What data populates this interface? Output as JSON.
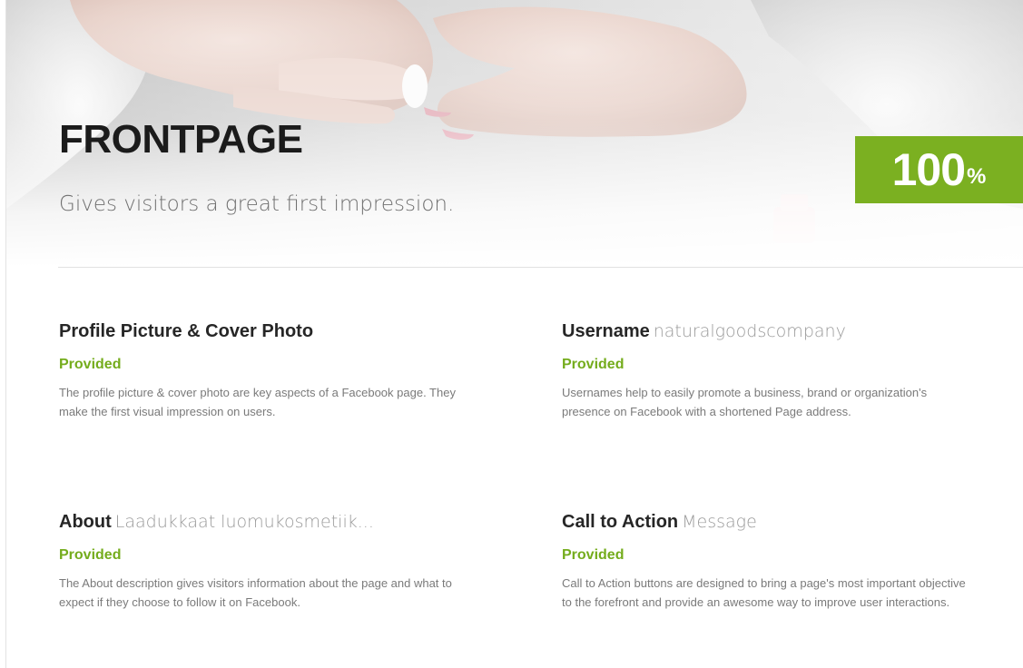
{
  "hero": {
    "title": "FRONTPAGE",
    "subtitle": "Gives visitors a great first impression.",
    "score": {
      "value": "100",
      "unit": "%"
    }
  },
  "items": [
    {
      "name": "Profile Picture & Cover Photo",
      "value": "",
      "status": "Provided",
      "description": "The profile picture & cover photo are key aspects of a Facebook page. They make the first visual impression on users."
    },
    {
      "name": "Username",
      "value": "naturalgoodscompany",
      "status": "Provided",
      "description": "Usernames help to easily promote a business, brand or organization's presence on Facebook with a shortened Page address."
    },
    {
      "name": "About",
      "value": "Laadukkaat luomukosmetiik...",
      "status": "Provided",
      "description": "The About description gives visitors information about the page and what to expect if they choose to follow it on Facebook."
    },
    {
      "name": "Call to Action",
      "value": "Message",
      "status": "Provided",
      "description": "Call to Action buttons are designed to bring a page's most important objective to the forefront and provide an awesome way to improve user interactions."
    }
  ],
  "colors": {
    "accent": "#7bb021",
    "status_text": "#74ac1c"
  }
}
